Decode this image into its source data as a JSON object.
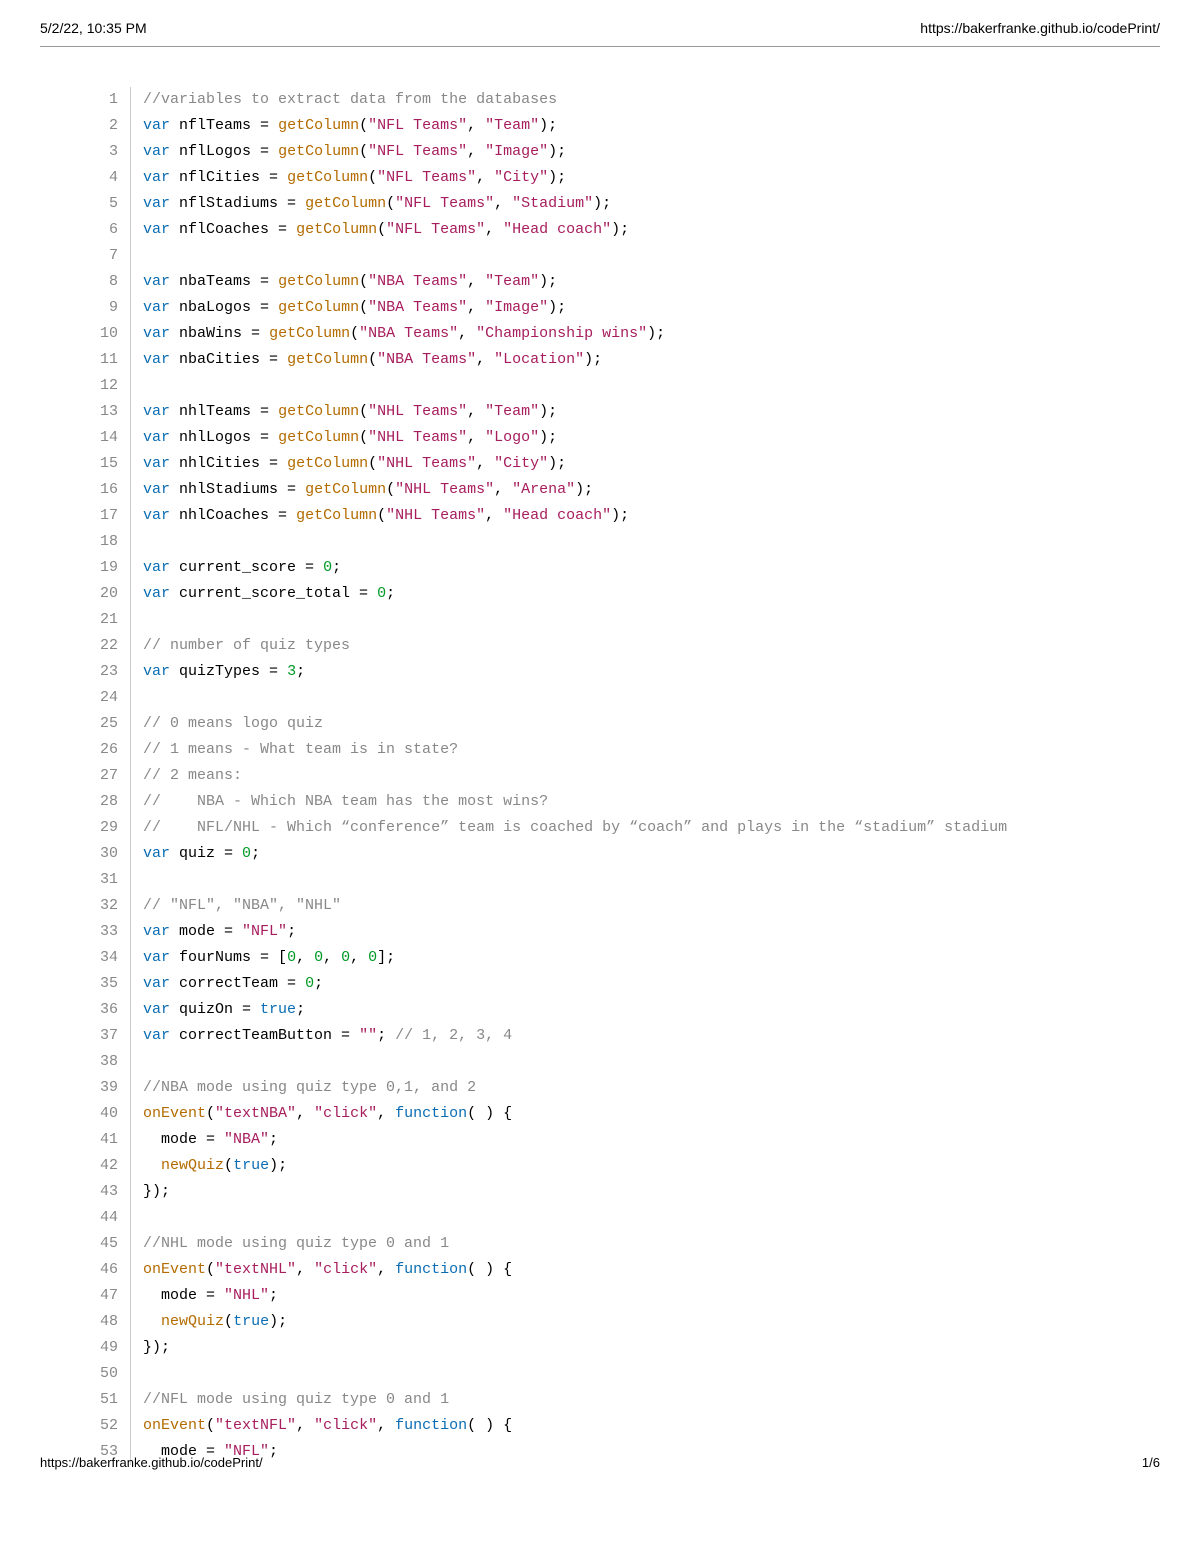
{
  "header": {
    "timestamp": "5/2/22, 10:35 PM",
    "url": "https://bakerfranke.github.io/codePrint/"
  },
  "footer": {
    "url": "https://bakerfranke.github.io/codePrint/",
    "page": "1/6"
  },
  "code": {
    "lines": [
      [
        {
          "t": "cm",
          "v": "//variables to extract data from the databases"
        }
      ],
      [
        {
          "t": "kw",
          "v": "var"
        },
        {
          "t": "id",
          "v": " nflTeams = "
        },
        {
          "t": "fn",
          "v": "getColumn"
        },
        {
          "t": "id",
          "v": "("
        },
        {
          "t": "str",
          "v": "\"NFL Teams\""
        },
        {
          "t": "id",
          "v": ", "
        },
        {
          "t": "str",
          "v": "\"Team\""
        },
        {
          "t": "id",
          "v": ");"
        }
      ],
      [
        {
          "t": "kw",
          "v": "var"
        },
        {
          "t": "id",
          "v": " nflLogos = "
        },
        {
          "t": "fn",
          "v": "getColumn"
        },
        {
          "t": "id",
          "v": "("
        },
        {
          "t": "str",
          "v": "\"NFL Teams\""
        },
        {
          "t": "id",
          "v": ", "
        },
        {
          "t": "str",
          "v": "\"Image\""
        },
        {
          "t": "id",
          "v": ");"
        }
      ],
      [
        {
          "t": "kw",
          "v": "var"
        },
        {
          "t": "id",
          "v": " nflCities = "
        },
        {
          "t": "fn",
          "v": "getColumn"
        },
        {
          "t": "id",
          "v": "("
        },
        {
          "t": "str",
          "v": "\"NFL Teams\""
        },
        {
          "t": "id",
          "v": ", "
        },
        {
          "t": "str",
          "v": "\"City\""
        },
        {
          "t": "id",
          "v": ");"
        }
      ],
      [
        {
          "t": "kw",
          "v": "var"
        },
        {
          "t": "id",
          "v": " nflStadiums = "
        },
        {
          "t": "fn",
          "v": "getColumn"
        },
        {
          "t": "id",
          "v": "("
        },
        {
          "t": "str",
          "v": "\"NFL Teams\""
        },
        {
          "t": "id",
          "v": ", "
        },
        {
          "t": "str",
          "v": "\"Stadium\""
        },
        {
          "t": "id",
          "v": ");"
        }
      ],
      [
        {
          "t": "kw",
          "v": "var"
        },
        {
          "t": "id",
          "v": " nflCoaches = "
        },
        {
          "t": "fn",
          "v": "getColumn"
        },
        {
          "t": "id",
          "v": "("
        },
        {
          "t": "str",
          "v": "\"NFL Teams\""
        },
        {
          "t": "id",
          "v": ", "
        },
        {
          "t": "str",
          "v": "\"Head coach\""
        },
        {
          "t": "id",
          "v": ");"
        }
      ],
      [],
      [
        {
          "t": "kw",
          "v": "var"
        },
        {
          "t": "id",
          "v": " nbaTeams = "
        },
        {
          "t": "fn",
          "v": "getColumn"
        },
        {
          "t": "id",
          "v": "("
        },
        {
          "t": "str",
          "v": "\"NBA Teams\""
        },
        {
          "t": "id",
          "v": ", "
        },
        {
          "t": "str",
          "v": "\"Team\""
        },
        {
          "t": "id",
          "v": ");"
        }
      ],
      [
        {
          "t": "kw",
          "v": "var"
        },
        {
          "t": "id",
          "v": " nbaLogos = "
        },
        {
          "t": "fn",
          "v": "getColumn"
        },
        {
          "t": "id",
          "v": "("
        },
        {
          "t": "str",
          "v": "\"NBA Teams\""
        },
        {
          "t": "id",
          "v": ", "
        },
        {
          "t": "str",
          "v": "\"Image\""
        },
        {
          "t": "id",
          "v": ");"
        }
      ],
      [
        {
          "t": "kw",
          "v": "var"
        },
        {
          "t": "id",
          "v": " nbaWins = "
        },
        {
          "t": "fn",
          "v": "getColumn"
        },
        {
          "t": "id",
          "v": "("
        },
        {
          "t": "str",
          "v": "\"NBA Teams\""
        },
        {
          "t": "id",
          "v": ", "
        },
        {
          "t": "str",
          "v": "\"Championship wins\""
        },
        {
          "t": "id",
          "v": ");"
        }
      ],
      [
        {
          "t": "kw",
          "v": "var"
        },
        {
          "t": "id",
          "v": " nbaCities = "
        },
        {
          "t": "fn",
          "v": "getColumn"
        },
        {
          "t": "id",
          "v": "("
        },
        {
          "t": "str",
          "v": "\"NBA Teams\""
        },
        {
          "t": "id",
          "v": ", "
        },
        {
          "t": "str",
          "v": "\"Location\""
        },
        {
          "t": "id",
          "v": ");"
        }
      ],
      [],
      [
        {
          "t": "kw",
          "v": "var"
        },
        {
          "t": "id",
          "v": " nhlTeams = "
        },
        {
          "t": "fn",
          "v": "getColumn"
        },
        {
          "t": "id",
          "v": "("
        },
        {
          "t": "str",
          "v": "\"NHL Teams\""
        },
        {
          "t": "id",
          "v": ", "
        },
        {
          "t": "str",
          "v": "\"Team\""
        },
        {
          "t": "id",
          "v": ");"
        }
      ],
      [
        {
          "t": "kw",
          "v": "var"
        },
        {
          "t": "id",
          "v": " nhlLogos = "
        },
        {
          "t": "fn",
          "v": "getColumn"
        },
        {
          "t": "id",
          "v": "("
        },
        {
          "t": "str",
          "v": "\"NHL Teams\""
        },
        {
          "t": "id",
          "v": ", "
        },
        {
          "t": "str",
          "v": "\"Logo\""
        },
        {
          "t": "id",
          "v": ");"
        }
      ],
      [
        {
          "t": "kw",
          "v": "var"
        },
        {
          "t": "id",
          "v": " nhlCities = "
        },
        {
          "t": "fn",
          "v": "getColumn"
        },
        {
          "t": "id",
          "v": "("
        },
        {
          "t": "str",
          "v": "\"NHL Teams\""
        },
        {
          "t": "id",
          "v": ", "
        },
        {
          "t": "str",
          "v": "\"City\""
        },
        {
          "t": "id",
          "v": ");"
        }
      ],
      [
        {
          "t": "kw",
          "v": "var"
        },
        {
          "t": "id",
          "v": " nhlStadiums = "
        },
        {
          "t": "fn",
          "v": "getColumn"
        },
        {
          "t": "id",
          "v": "("
        },
        {
          "t": "str",
          "v": "\"NHL Teams\""
        },
        {
          "t": "id",
          "v": ", "
        },
        {
          "t": "str",
          "v": "\"Arena\""
        },
        {
          "t": "id",
          "v": ");"
        }
      ],
      [
        {
          "t": "kw",
          "v": "var"
        },
        {
          "t": "id",
          "v": " nhlCoaches = "
        },
        {
          "t": "fn",
          "v": "getColumn"
        },
        {
          "t": "id",
          "v": "("
        },
        {
          "t": "str",
          "v": "\"NHL Teams\""
        },
        {
          "t": "id",
          "v": ", "
        },
        {
          "t": "str",
          "v": "\"Head coach\""
        },
        {
          "t": "id",
          "v": ");"
        }
      ],
      [],
      [
        {
          "t": "kw",
          "v": "var"
        },
        {
          "t": "id",
          "v": " current_score = "
        },
        {
          "t": "num",
          "v": "0"
        },
        {
          "t": "id",
          "v": ";"
        }
      ],
      [
        {
          "t": "kw",
          "v": "var"
        },
        {
          "t": "id",
          "v": " current_score_total = "
        },
        {
          "t": "num",
          "v": "0"
        },
        {
          "t": "id",
          "v": ";"
        }
      ],
      [],
      [
        {
          "t": "cm",
          "v": "// number of quiz types"
        }
      ],
      [
        {
          "t": "kw",
          "v": "var"
        },
        {
          "t": "id",
          "v": " quizTypes = "
        },
        {
          "t": "num",
          "v": "3"
        },
        {
          "t": "id",
          "v": ";"
        }
      ],
      [],
      [
        {
          "t": "cm",
          "v": "// 0 means logo quiz"
        }
      ],
      [
        {
          "t": "cm",
          "v": "// 1 means - What team is in state?"
        }
      ],
      [
        {
          "t": "cm",
          "v": "// 2 means:"
        }
      ],
      [
        {
          "t": "cm",
          "v": "//    NBA - Which NBA team has the most wins?"
        }
      ],
      [
        {
          "t": "cm",
          "v": "//    NFL/NHL - Which “conference” team is coached by “coach” and plays in the “stadium” stadium"
        }
      ],
      [
        {
          "t": "kw",
          "v": "var"
        },
        {
          "t": "id",
          "v": " quiz = "
        },
        {
          "t": "num",
          "v": "0"
        },
        {
          "t": "id",
          "v": ";"
        }
      ],
      [],
      [
        {
          "t": "cm",
          "v": "// \"NFL\", \"NBA\", \"NHL\""
        }
      ],
      [
        {
          "t": "kw",
          "v": "var"
        },
        {
          "t": "id",
          "v": " mode = "
        },
        {
          "t": "str",
          "v": "\"NFL\""
        },
        {
          "t": "id",
          "v": ";"
        }
      ],
      [
        {
          "t": "kw",
          "v": "var"
        },
        {
          "t": "id",
          "v": " fourNums = ["
        },
        {
          "t": "num",
          "v": "0"
        },
        {
          "t": "id",
          "v": ", "
        },
        {
          "t": "num",
          "v": "0"
        },
        {
          "t": "id",
          "v": ", "
        },
        {
          "t": "num",
          "v": "0"
        },
        {
          "t": "id",
          "v": ", "
        },
        {
          "t": "num",
          "v": "0"
        },
        {
          "t": "id",
          "v": "];"
        }
      ],
      [
        {
          "t": "kw",
          "v": "var"
        },
        {
          "t": "id",
          "v": " correctTeam = "
        },
        {
          "t": "num",
          "v": "0"
        },
        {
          "t": "id",
          "v": ";"
        }
      ],
      [
        {
          "t": "kw",
          "v": "var"
        },
        {
          "t": "id",
          "v": " quizOn = "
        },
        {
          "t": "bool",
          "v": "true"
        },
        {
          "t": "id",
          "v": ";"
        }
      ],
      [
        {
          "t": "kw",
          "v": "var"
        },
        {
          "t": "id",
          "v": " correctTeamButton = "
        },
        {
          "t": "str",
          "v": "\"\""
        },
        {
          "t": "id",
          "v": "; "
        },
        {
          "t": "cm",
          "v": "// 1, 2, 3, 4"
        }
      ],
      [],
      [
        {
          "t": "cm",
          "v": "//NBA mode using quiz type 0,1, and 2"
        }
      ],
      [
        {
          "t": "fn",
          "v": "onEvent"
        },
        {
          "t": "id",
          "v": "("
        },
        {
          "t": "str",
          "v": "\"textNBA\""
        },
        {
          "t": "id",
          "v": ", "
        },
        {
          "t": "str",
          "v": "\"click\""
        },
        {
          "t": "id",
          "v": ", "
        },
        {
          "t": "kw",
          "v": "function"
        },
        {
          "t": "id",
          "v": "( ) {"
        }
      ],
      [
        {
          "t": "id",
          "v": "  mode = "
        },
        {
          "t": "str",
          "v": "\"NBA\""
        },
        {
          "t": "id",
          "v": ";"
        }
      ],
      [
        {
          "t": "id",
          "v": "  "
        },
        {
          "t": "fn",
          "v": "newQuiz"
        },
        {
          "t": "id",
          "v": "("
        },
        {
          "t": "bool",
          "v": "true"
        },
        {
          "t": "id",
          "v": ");"
        }
      ],
      [
        {
          "t": "id",
          "v": "});"
        }
      ],
      [],
      [
        {
          "t": "cm",
          "v": "//NHL mode using quiz type 0 and 1"
        }
      ],
      [
        {
          "t": "fn",
          "v": "onEvent"
        },
        {
          "t": "id",
          "v": "("
        },
        {
          "t": "str",
          "v": "\"textNHL\""
        },
        {
          "t": "id",
          "v": ", "
        },
        {
          "t": "str",
          "v": "\"click\""
        },
        {
          "t": "id",
          "v": ", "
        },
        {
          "t": "kw",
          "v": "function"
        },
        {
          "t": "id",
          "v": "( ) {"
        }
      ],
      [
        {
          "t": "id",
          "v": "  mode = "
        },
        {
          "t": "str",
          "v": "\"NHL\""
        },
        {
          "t": "id",
          "v": ";"
        }
      ],
      [
        {
          "t": "id",
          "v": "  "
        },
        {
          "t": "fn",
          "v": "newQuiz"
        },
        {
          "t": "id",
          "v": "("
        },
        {
          "t": "bool",
          "v": "true"
        },
        {
          "t": "id",
          "v": ");"
        }
      ],
      [
        {
          "t": "id",
          "v": "});"
        }
      ],
      [],
      [
        {
          "t": "cm",
          "v": "//NFL mode using quiz type 0 and 1"
        }
      ],
      [
        {
          "t": "fn",
          "v": "onEvent"
        },
        {
          "t": "id",
          "v": "("
        },
        {
          "t": "str",
          "v": "\"textNFL\""
        },
        {
          "t": "id",
          "v": ", "
        },
        {
          "t": "str",
          "v": "\"click\""
        },
        {
          "t": "id",
          "v": ", "
        },
        {
          "t": "kw",
          "v": "function"
        },
        {
          "t": "id",
          "v": "( ) {"
        }
      ],
      [
        {
          "t": "id",
          "v": "  mode = "
        },
        {
          "t": "str",
          "v": "\"NFL\""
        },
        {
          "t": "id",
          "v": ";"
        }
      ]
    ]
  }
}
